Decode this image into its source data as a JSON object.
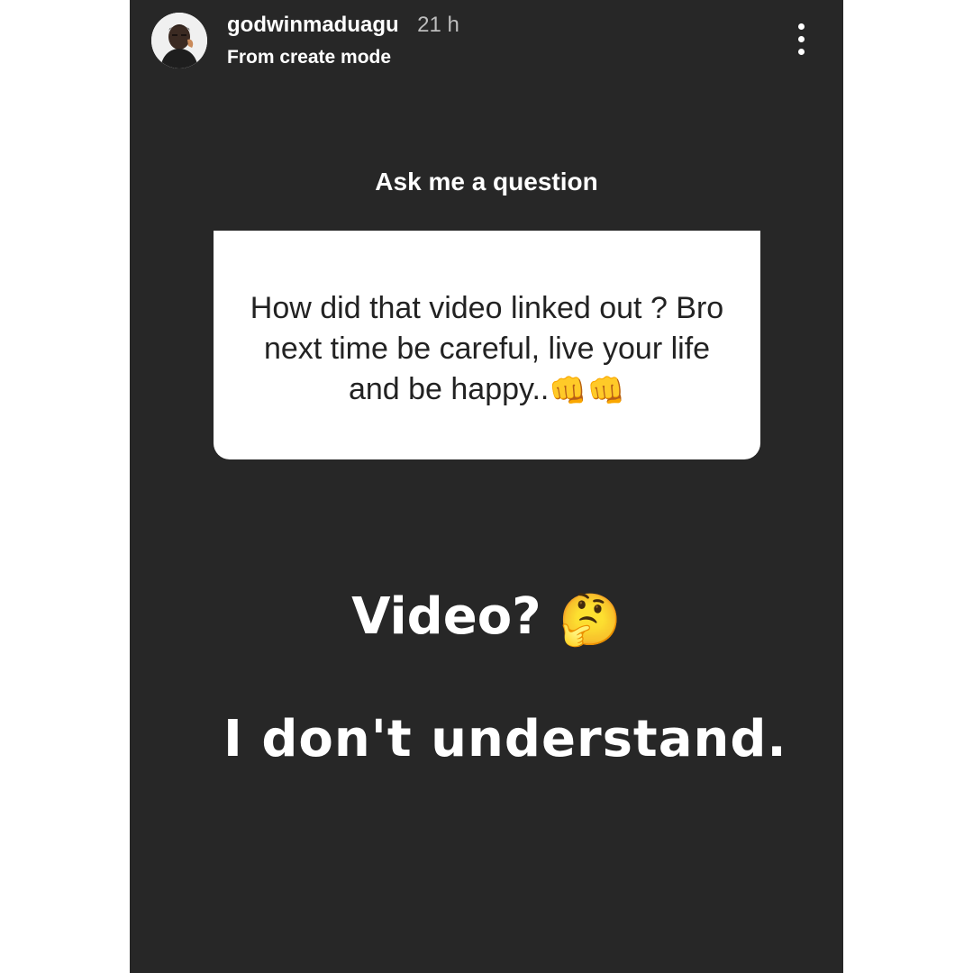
{
  "header": {
    "username": "godwinmaduagu",
    "time": "21 h",
    "subtitle": "From create mode",
    "avatar_icon": "profile-photo",
    "menu_icon": "more-vertical-icon"
  },
  "sticker": {
    "prompt": "Ask me a question",
    "question_text": "How did that video linked out ? Bro next time be careful, live your life and be happy..",
    "question_emoji": "👊👊"
  },
  "captions": {
    "line1": "Video?",
    "line1_emoji": "🤔",
    "line2": "I don't understand."
  },
  "colors": {
    "background": "#272727",
    "card": "#ffffff",
    "text_light": "#ffffff",
    "text_dark": "#222222"
  }
}
